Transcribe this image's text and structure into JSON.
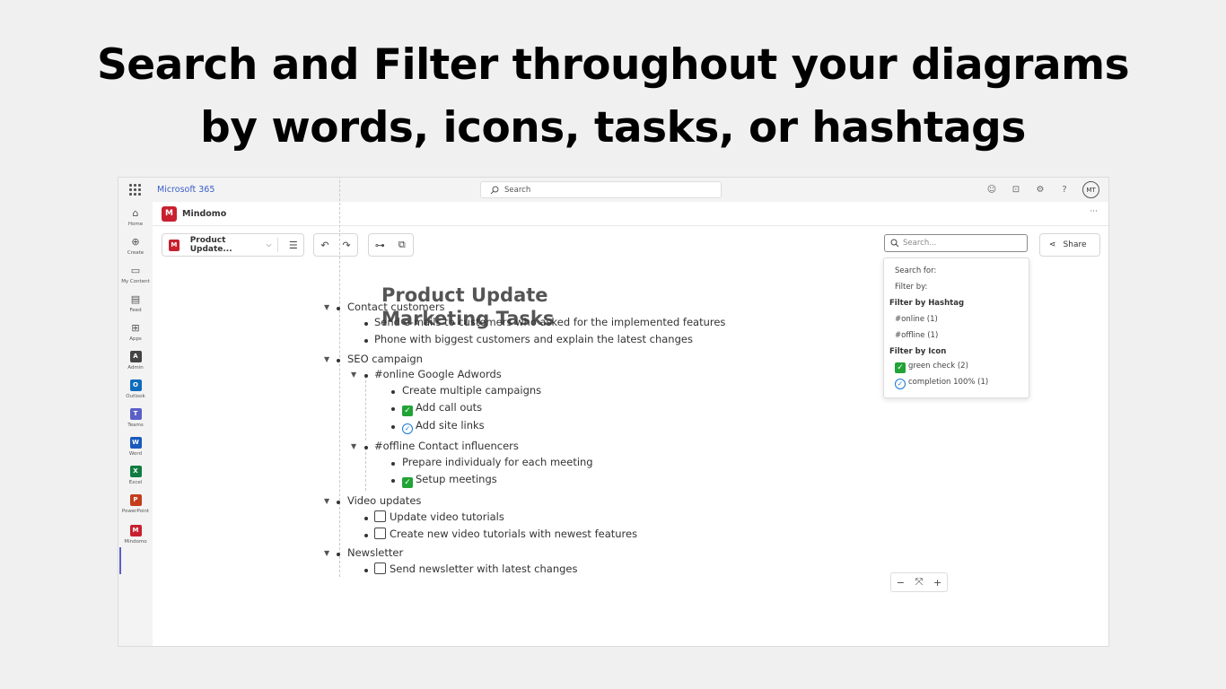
{
  "headline": {
    "line1": "Search and Filter throughout your diagrams",
    "line2": "by words, icons, tasks, or hashtags"
  },
  "m365": {
    "title": "Microsoft 365",
    "search_placeholder": "Search",
    "avatar": "MT"
  },
  "rail": {
    "items": [
      {
        "label": "Home",
        "icon": "home-icon"
      },
      {
        "label": "Create",
        "icon": "create-icon"
      },
      {
        "label": "My Content",
        "icon": "folder-icon"
      },
      {
        "label": "Feed",
        "icon": "feed-icon"
      },
      {
        "label": "Apps",
        "icon": "apps-icon"
      },
      {
        "label": "Admin",
        "icon": "admin-icon",
        "color": "#444444",
        "glyph": "A"
      },
      {
        "label": "Outlook",
        "icon": "outlook-icon",
        "color": "#0f6cbd",
        "glyph": "O"
      },
      {
        "label": "Teams",
        "icon": "teams-icon",
        "color": "#5b5fc7",
        "glyph": "T"
      },
      {
        "label": "Word",
        "icon": "word-icon",
        "color": "#185abd",
        "glyph": "W"
      },
      {
        "label": "Excel",
        "icon": "excel-icon",
        "color": "#107c41",
        "glyph": "X"
      },
      {
        "label": "PowerPoint",
        "icon": "powerpoint-icon",
        "color": "#c43e1c",
        "glyph": "P"
      },
      {
        "label": "Mindomo",
        "icon": "mindomo-icon",
        "color": "#c8202f",
        "glyph": "M"
      }
    ]
  },
  "app": {
    "name": "Mindomo",
    "more": "···"
  },
  "toolbar": {
    "doc_name": "Product Update...",
    "search_placeholder": "Search...",
    "share_label": "Share"
  },
  "search_dropdown": {
    "search_for": "Search for:",
    "filter_by": "Filter by:",
    "hashtag_header": "Filter by Hashtag",
    "hashtags": [
      "#online (1)",
      "#offline (1)"
    ],
    "icon_header": "Filter by Icon",
    "icons": [
      "green check (2)",
      "completion 100% (1)"
    ]
  },
  "map": {
    "title_line1": "Product Update",
    "title_line2": "Marketing Tasks",
    "topics": {
      "contact": "Contact customers",
      "contact_1": "Send e-mails to customers who asked for the implemented features",
      "contact_2": "Phone with biggest customers and explain the latest changes",
      "seo": "SEO campaign",
      "seo_online": "#online Google Adwords",
      "seo_online_1": "Create multiple campaigns",
      "seo_online_2": "Add call outs",
      "seo_online_3": "Add site links",
      "seo_offline": "#offline Contact influencers",
      "seo_offline_1": "Prepare individualy for each meeting",
      "seo_offline_2": "Setup meetings",
      "video": "Video updates",
      "video_1": "Update video tutorials",
      "video_2": "Create new video tutorials with newest features",
      "newsletter": "Newsletter",
      "newsletter_1": "Send newsletter with latest changes"
    }
  },
  "zoom": {
    "minus": "−",
    "fit": "⤧",
    "plus": "+"
  }
}
